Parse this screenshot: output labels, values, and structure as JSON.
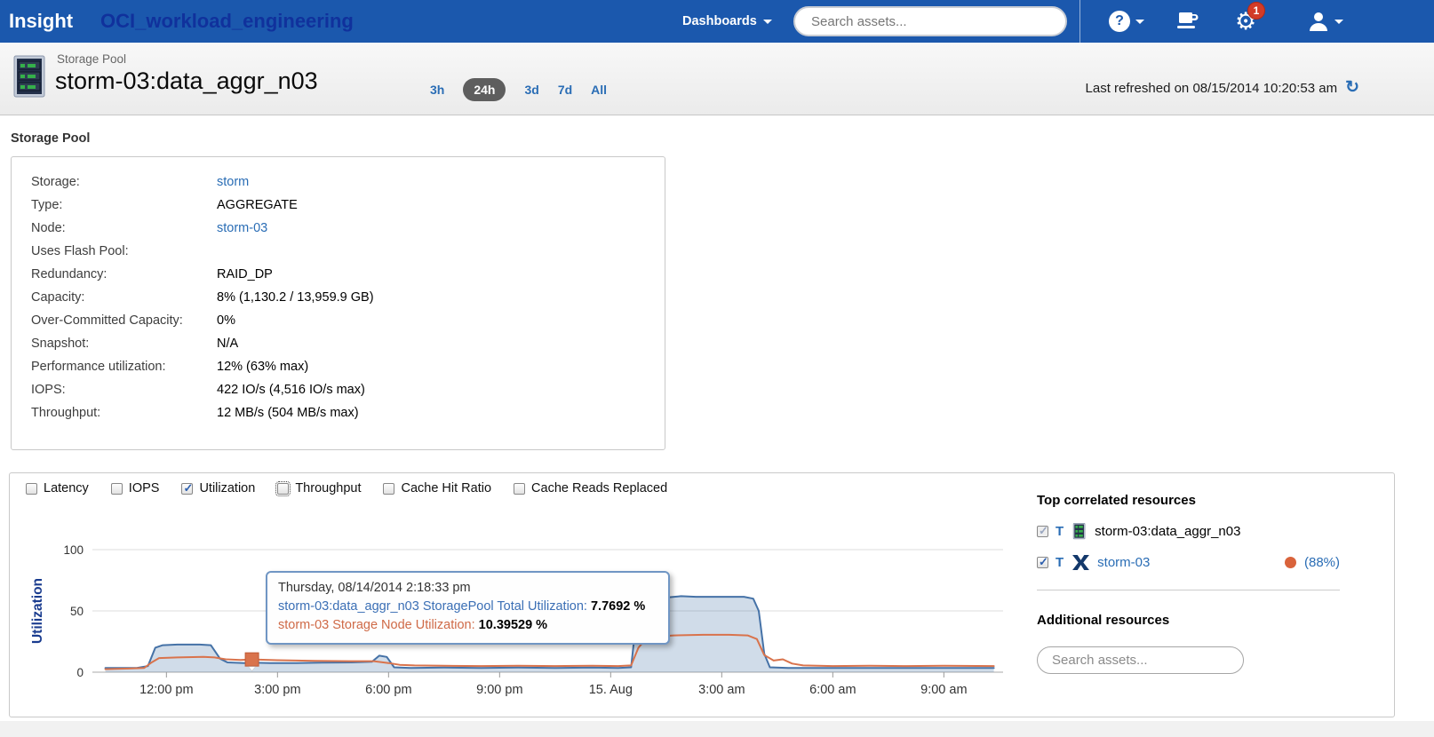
{
  "topbar": {
    "brand": "Insight",
    "workspace": "OCI_workload_engineering",
    "dashboards_label": "Dashboards",
    "search_placeholder": "Search assets...",
    "notification_count": "1"
  },
  "icons": {
    "help": "?",
    "gear": "⚙",
    "refresh": "↻"
  },
  "header": {
    "asset_type": "Storage Pool",
    "asset_name": "storm-03:data_aggr_n03",
    "time_ranges": [
      {
        "label": "3h",
        "selected": false
      },
      {
        "label": "24h",
        "selected": true
      },
      {
        "label": "3d",
        "selected": false
      },
      {
        "label": "7d",
        "selected": false
      },
      {
        "label": "All",
        "selected": false
      }
    ],
    "last_refreshed": "Last refreshed on 08/15/2014 10:20:53 am"
  },
  "details": {
    "section_title": "Storage Pool",
    "rows": [
      {
        "label": "Storage:",
        "value": "storm",
        "link": true
      },
      {
        "label": "Type:",
        "value": "AGGREGATE",
        "link": false
      },
      {
        "label": "Node:",
        "value": "storm-03",
        "link": true
      },
      {
        "label": "Uses Flash Pool:",
        "value": "",
        "link": false
      },
      {
        "label": "Redundancy:",
        "value": "RAID_DP",
        "link": false
      },
      {
        "label": "Capacity:",
        "value": "8% (1,130.2 / 13,959.9 GB)",
        "link": false
      },
      {
        "label": "Over-Committed Capacity:",
        "value": "0%",
        "link": false
      },
      {
        "label": "Snapshot:",
        "value": "N/A",
        "link": false
      },
      {
        "label": "Performance utilization:",
        "value": "12% (63% max)",
        "link": false
      },
      {
        "label": "IOPS:",
        "value": "422 IO/s (4,516 IO/s max)",
        "link": false
      },
      {
        "label": "Throughput:",
        "value": "12 MB/s (504 MB/s max)",
        "link": false
      }
    ]
  },
  "metrics_toggles": [
    {
      "label": "Latency",
      "checked": false,
      "focused": false
    },
    {
      "label": "IOPS",
      "checked": false,
      "focused": false
    },
    {
      "label": "Utilization",
      "checked": true,
      "focused": false
    },
    {
      "label": "Throughput",
      "checked": false,
      "focused": true
    },
    {
      "label": "Cache Hit Ratio",
      "checked": false,
      "focused": false
    },
    {
      "label": "Cache Reads Replaced",
      "checked": false,
      "focused": false
    }
  ],
  "chart_data": {
    "type": "area",
    "title": "",
    "ylabel": "Utilization",
    "ylim": [
      0,
      100
    ],
    "yticks": [
      0,
      50,
      100
    ],
    "grid": true,
    "legend_position": "none",
    "x_unit": "hours since 08/14/2014 10:00 am",
    "xticks": [
      {
        "t": 2,
        "label": "12:00 pm"
      },
      {
        "t": 5,
        "label": "3:00 pm"
      },
      {
        "t": 8,
        "label": "6:00 pm"
      },
      {
        "t": 11,
        "label": "9:00 pm"
      },
      {
        "t": 14,
        "label": "15. Aug"
      },
      {
        "t": 17,
        "label": "3:00 am"
      },
      {
        "t": 20,
        "label": "6:00 am"
      },
      {
        "t": 23,
        "label": "9:00 am"
      }
    ],
    "series": [
      {
        "name": "storm-03:data_aggr_n03 StoragePool Total Utilization",
        "color": "#4572a7",
        "fill": true,
        "fill_color": "rgba(69,114,167,0.25)",
        "points": [
          [
            0.35,
            3.5
          ],
          [
            1.2,
            3.5
          ],
          [
            1.5,
            5
          ],
          [
            1.7,
            20
          ],
          [
            1.9,
            22
          ],
          [
            2.3,
            22.5
          ],
          [
            2.9,
            22.5
          ],
          [
            3.2,
            22
          ],
          [
            3.45,
            11
          ],
          [
            3.65,
            8
          ],
          [
            4.1,
            7.5
          ],
          [
            4.31,
            7.77
          ],
          [
            4.8,
            7.5
          ],
          [
            5.5,
            7.5
          ],
          [
            6.2,
            7.8
          ],
          [
            7.0,
            8
          ],
          [
            7.55,
            8.5
          ],
          [
            7.75,
            13.5
          ],
          [
            7.95,
            12.5
          ],
          [
            8.15,
            4
          ],
          [
            8.6,
            3.5
          ],
          [
            9.5,
            3.8
          ],
          [
            10.5,
            3.5
          ],
          [
            11.5,
            3.8
          ],
          [
            12.5,
            3.5
          ],
          [
            13.5,
            3.8
          ],
          [
            14.2,
            3.5
          ],
          [
            14.55,
            4
          ],
          [
            14.7,
            45
          ],
          [
            14.85,
            60
          ],
          [
            15.0,
            62
          ],
          [
            15.15,
            64
          ],
          [
            15.3,
            59
          ],
          [
            15.55,
            61
          ],
          [
            15.9,
            62
          ],
          [
            16.3,
            61.5
          ],
          [
            17.0,
            61.5
          ],
          [
            17.6,
            61.5
          ],
          [
            17.85,
            60
          ],
          [
            18.0,
            50
          ],
          [
            18.15,
            15
          ],
          [
            18.3,
            4
          ],
          [
            18.8,
            3.5
          ],
          [
            19.5,
            3.5
          ],
          [
            20.5,
            3.5
          ],
          [
            21.5,
            3.5
          ],
          [
            22.5,
            3.5
          ],
          [
            23.5,
            3.5
          ],
          [
            24.35,
            3.5
          ]
        ]
      },
      {
        "name": "storm-03 Storage Node Utilization",
        "color": "#d9734c",
        "fill": false,
        "fill_color": null,
        "points": [
          [
            0.35,
            2.5
          ],
          [
            1.0,
            3
          ],
          [
            1.4,
            3.5
          ],
          [
            1.6,
            8
          ],
          [
            1.8,
            11.5
          ],
          [
            2.3,
            12
          ],
          [
            3.0,
            12.5
          ],
          [
            3.3,
            12
          ],
          [
            3.6,
            10.5
          ],
          [
            4.0,
            10
          ],
          [
            4.31,
            10.4
          ],
          [
            5.0,
            9.8
          ],
          [
            6.0,
            9.3
          ],
          [
            7.0,
            9
          ],
          [
            7.6,
            9
          ],
          [
            8.0,
            7.5
          ],
          [
            8.3,
            6
          ],
          [
            8.7,
            5.5
          ],
          [
            9.5,
            5.2
          ],
          [
            10.5,
            5
          ],
          [
            11.5,
            5.2
          ],
          [
            12.5,
            5
          ],
          [
            13.5,
            5.2
          ],
          [
            14.2,
            5
          ],
          [
            14.55,
            5.5
          ],
          [
            14.75,
            20
          ],
          [
            14.95,
            27
          ],
          [
            15.2,
            29
          ],
          [
            15.7,
            30
          ],
          [
            16.5,
            30.5
          ],
          [
            17.2,
            30.5
          ],
          [
            17.7,
            30
          ],
          [
            17.95,
            27
          ],
          [
            18.15,
            14
          ],
          [
            18.4,
            9.5
          ],
          [
            18.65,
            10.5
          ],
          [
            18.9,
            7
          ],
          [
            19.2,
            5.5
          ],
          [
            20,
            5
          ],
          [
            21,
            5.2
          ],
          [
            22,
            5
          ],
          [
            23,
            5.2
          ],
          [
            24.35,
            5
          ]
        ]
      }
    ],
    "marker": {
      "series": "storm-03 Storage Node Utilization",
      "t": 4.31,
      "value": 10.39529,
      "shape": "square",
      "color": "#d9734c"
    }
  },
  "tooltip": {
    "timestamp": "Thursday, 08/14/2014 2:18:33 pm",
    "series1_label": "storm-03:data_aggr_n03 StoragePool Total Utilization:",
    "series1_value": "7.7692 %",
    "series2_label": "storm-03 Storage Node Utilization:",
    "series2_value": "10.39529 %"
  },
  "correlated": {
    "title": "Top correlated resources",
    "rows": [
      {
        "checked": true,
        "disabled": true,
        "trend": "T",
        "icon": "storage-pool",
        "name": "storm-03:data_aggr_n03",
        "is_link": false,
        "correlation": null
      },
      {
        "checked": true,
        "disabled": false,
        "trend": "T",
        "icon": "node",
        "name": "storm-03",
        "is_link": true,
        "correlation": "(88%)"
      }
    ],
    "correlation_dot_color": "#d9633b"
  },
  "additional": {
    "title": "Additional resources",
    "search_placeholder": "Search assets..."
  },
  "colors": {
    "topbar_bg": "#1b58ad",
    "workspace_text": "#10319c",
    "link_blue": "#2a6db5",
    "selected_range_bg": "#5e5e5e",
    "series_total": "#4572a7",
    "series_node": "#d9734c",
    "badge_red": "#d23b27",
    "axis_title_navy": "#1a3c8f"
  }
}
